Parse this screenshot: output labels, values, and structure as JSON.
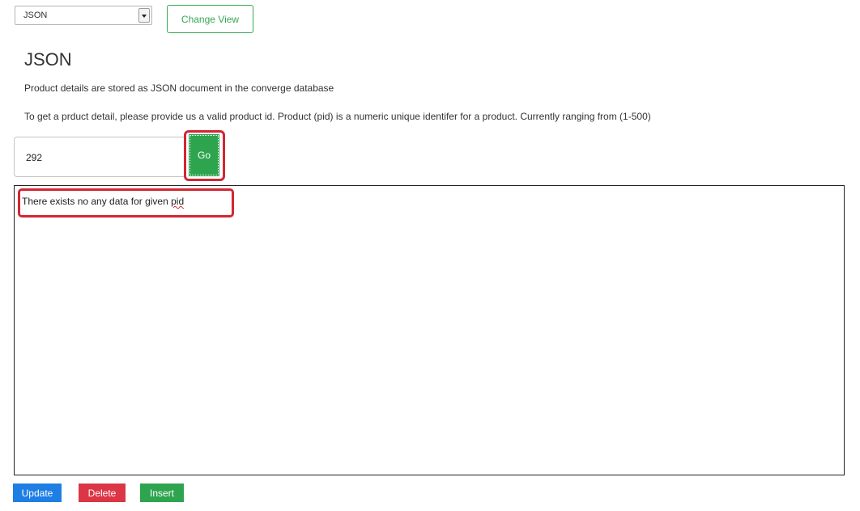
{
  "view_select": {
    "selected": "JSON",
    "icon": "chevron-down-icon"
  },
  "change_view_label": "Change View",
  "page_title": "JSON",
  "description_1": "Product details are stored as JSON document in the converge database",
  "description_2": "To get a prduct detail, please provide us a valid product id. Product (pid) is a numeric unique identifer for a product. Currently ranging from (1-500)",
  "pid_input": {
    "value": "292"
  },
  "go_label": "Go",
  "result": {
    "message_prefix": "There exists no any data for given ",
    "message_typo": "pid"
  },
  "actions": {
    "update_label": "Update",
    "delete_label": "Delete",
    "insert_label": "Insert"
  },
  "colors": {
    "primary": "#1e7ee4",
    "danger": "#dc3545",
    "success": "#2ea44f",
    "highlight": "#d32733"
  }
}
